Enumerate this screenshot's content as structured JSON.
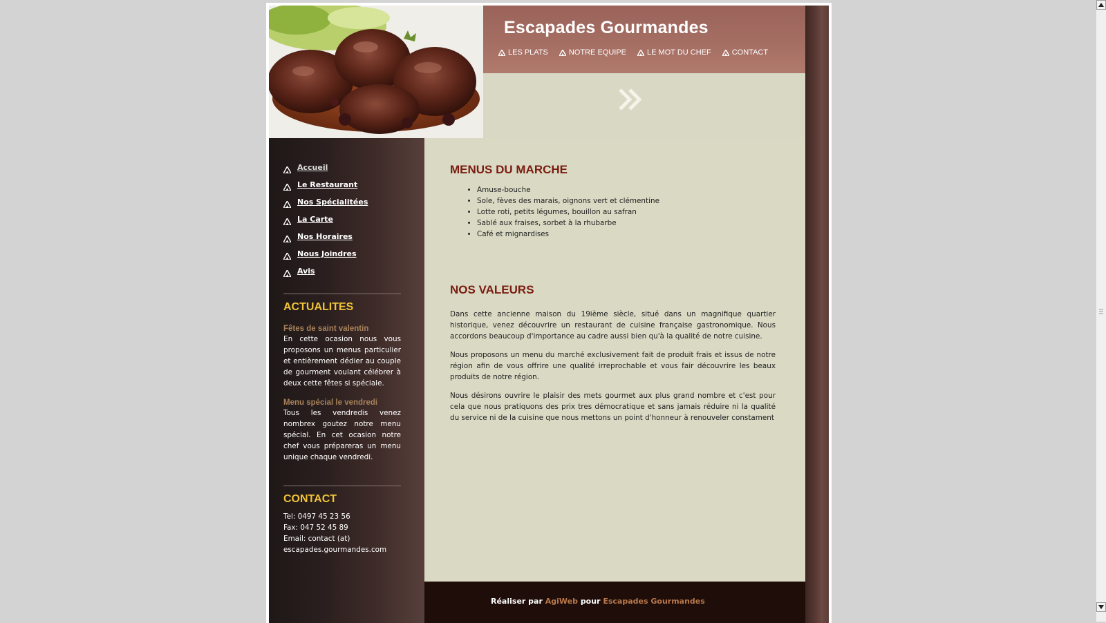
{
  "site": {
    "title": "Escapades Gourmandes"
  },
  "top_nav": [
    {
      "label": "LES PLATS"
    },
    {
      "label": "NOTRE EQUIPE"
    },
    {
      "label": "LE MOT DU CHEF"
    },
    {
      "label": "CONTACT"
    }
  ],
  "side_nav": [
    {
      "label": "Accueil"
    },
    {
      "label": "Le Restaurant"
    },
    {
      "label": "Nos Spécialitées"
    },
    {
      "label": "La Carte"
    },
    {
      "label": "Nos Horaires"
    },
    {
      "label": "Nous Joindres"
    },
    {
      "label": "Avis"
    }
  ],
  "actualites": {
    "heading": "ACTUALITES",
    "items": [
      {
        "title": "Fêtes de saint valentin",
        "body": "En cette ocasion nous vous proposons un menus particulier et entièrement dédier au couple de gourment voulant célébrer à deux cette fêtes si spéciale."
      },
      {
        "title": "Menu spécial le vendredi",
        "body": "Tous les vendredis venez nombrex goutez notre menu spécial. En cet ocasion notre chef vous prépareras un menu unique chaque vendredi."
      }
    ]
  },
  "contact": {
    "heading": "CONTACT",
    "tel": "Tel:  0497 45 23 56",
    "fax": "Fax: 047 52 45 89",
    "email_line1": "Email: contact (at)",
    "email_line2": "escapades.gourmandes.com"
  },
  "main": {
    "menus_heading": "MENUS DU MARCHE",
    "menu_items": [
      "Amuse-bouche",
      "Sole, fèves des marais, oignons vert et clémentine",
      "Lotte roti, petits légumes, bouillon au safran",
      "Sablé aux fraises, sorbet à la rhubarbe",
      "Café et mignardises"
    ],
    "valeurs_heading": "NOS VALEURS",
    "paragraphs": [
      "Dans cette ancienne maison du 19ième siècle, situé dans un magnifique quartier historique, venez découvrire un restaurant de cuisine française gastronomique. Nous accordons beaucoup d'importance au cadre aussi bien qu'à la qualité de notre cuisine.",
      "Nous proposons un menu du marché exclusivement fait de produit frais et issus de notre région afin de vous offrire une qualité irreprochable et vous fair découvrire les beaux produits de notre région.",
      "Nous désirons ouvrire le plaisir des mets gourmet aux plus grand nombre et c'est pour cela que nous pratiquons des prix tres démocratique et sans jamais réduire ni la qualité du service ni de la cuisine que nous mettons un point d'honneur à renouveler constament"
    ]
  },
  "footer": {
    "prefix": "Réaliser par",
    "agency": "AgiWeb",
    "middle": "pour",
    "client": "Escapades Gourmandes"
  },
  "colors": {
    "header_band": "#a56e63",
    "sidebar": "#2a1f1e",
    "main_bg": "#d9d9c4",
    "heading_red": "#7a1c10",
    "side_heading_yellow": "#f1c338",
    "news_title_tan": "#a8825b",
    "footer_bg": "#1e0d09",
    "footer_link": "#b8784a"
  },
  "icons": {
    "nav_bullet": "triangle-arrow-icon",
    "banner": "double-chevron-right-icon",
    "header_photo": "food-photo"
  }
}
